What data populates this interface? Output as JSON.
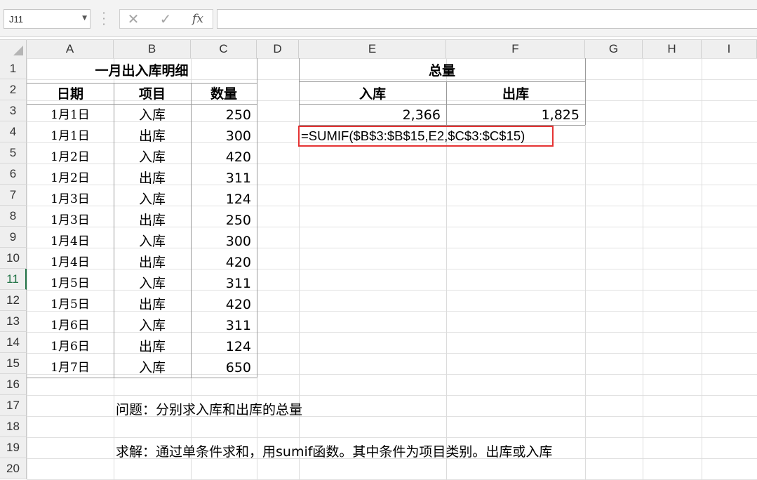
{
  "formula_bar": {
    "name_box": "J11",
    "cancel_icon": "✕",
    "enter_icon": "✓",
    "fx_label": "fx",
    "formula": ""
  },
  "columns": [
    "A",
    "B",
    "C",
    "D",
    "E",
    "F",
    "G",
    "H",
    "I"
  ],
  "rows": [
    "1",
    "2",
    "3",
    "4",
    "5",
    "6",
    "7",
    "8",
    "9",
    "10",
    "11",
    "12",
    "13",
    "14",
    "15",
    "16",
    "17",
    "18",
    "19",
    "20"
  ],
  "active_row": "11",
  "sheet": {
    "title": "一月出入库明细",
    "headers": [
      "日期",
      "项目",
      "数量"
    ],
    "records": [
      {
        "date": "1月1日",
        "item": "入库",
        "qty": "250"
      },
      {
        "date": "1月1日",
        "item": "出库",
        "qty": "300"
      },
      {
        "date": "1月2日",
        "item": "入库",
        "qty": "420"
      },
      {
        "date": "1月2日",
        "item": "出库",
        "qty": "311"
      },
      {
        "date": "1月3日",
        "item": "入库",
        "qty": "124"
      },
      {
        "date": "1月3日",
        "item": "出库",
        "qty": "250"
      },
      {
        "date": "1月4日",
        "item": "入库",
        "qty": "300"
      },
      {
        "date": "1月4日",
        "item": "出库",
        "qty": "420"
      },
      {
        "date": "1月5日",
        "item": "入库",
        "qty": "311"
      },
      {
        "date": "1月5日",
        "item": "出库",
        "qty": "420"
      },
      {
        "date": "1月6日",
        "item": "入库",
        "qty": "311"
      },
      {
        "date": "1月6日",
        "item": "出库",
        "qty": "124"
      },
      {
        "date": "1月7日",
        "item": "入库",
        "qty": "650"
      }
    ],
    "summary": {
      "title": "总量",
      "in_label": "入库",
      "out_label": "出库",
      "in_total": "2,366",
      "out_total": "1,825",
      "formula_text": "=SUMIF($B$3:$B$15,E2,$C$3:$C$15)"
    },
    "question": "问题：分别求入库和出库的总量",
    "solution": "求解：通过单条件求和，用sumif函数。其中条件为项目类别。出库或入库"
  },
  "colors": {
    "highlight_box": "#e53333",
    "active_accent": "#217346"
  }
}
